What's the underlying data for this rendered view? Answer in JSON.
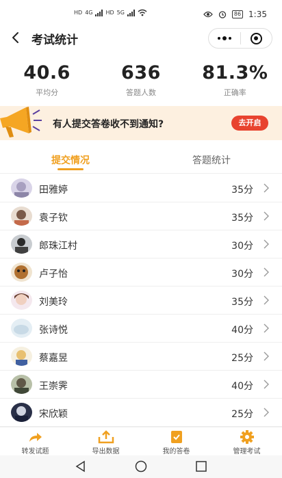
{
  "status": {
    "time": "1:35",
    "battery": "86",
    "sim1": "HD",
    "sim2": "HD",
    "net1": "4G",
    "net2": "5G"
  },
  "nav": {
    "title": "考试统计"
  },
  "stats": [
    {
      "value": "40.6",
      "label": "平均分"
    },
    {
      "value": "636",
      "label": "答题人数"
    },
    {
      "value": "81.3%",
      "label": "正确率"
    }
  ],
  "banner": {
    "text": "有人提交答卷收不到通知?",
    "button": "去开启"
  },
  "tabs": [
    {
      "label": "提交情况",
      "active": true
    },
    {
      "label": "答题统计",
      "active": false
    }
  ],
  "records": [
    {
      "name": "田雅婷",
      "score": "35分"
    },
    {
      "name": "袁子钦",
      "score": "35分"
    },
    {
      "name": "郎珠江村",
      "score": "30分"
    },
    {
      "name": "卢子怡",
      "score": "30分"
    },
    {
      "name": "刘美玲",
      "score": "35分"
    },
    {
      "name": "张诗悦",
      "score": "40分"
    },
    {
      "name": "蔡嘉昱",
      "score": "25分"
    },
    {
      "name": "王崇霁",
      "score": "40分"
    },
    {
      "name": "宋欣颖",
      "score": "25分"
    }
  ],
  "toolbar": [
    {
      "label": "转发试题",
      "icon": "share-arrow-icon"
    },
    {
      "label": "导出数据",
      "icon": "export-icon"
    },
    {
      "label": "我的答卷",
      "icon": "answer-sheet-icon"
    },
    {
      "label": "管理考试",
      "icon": "gear-icon"
    }
  ],
  "colors": {
    "accent": "#f0a020",
    "banner_bg": "#fdf0e0",
    "button": "#e8432f"
  }
}
